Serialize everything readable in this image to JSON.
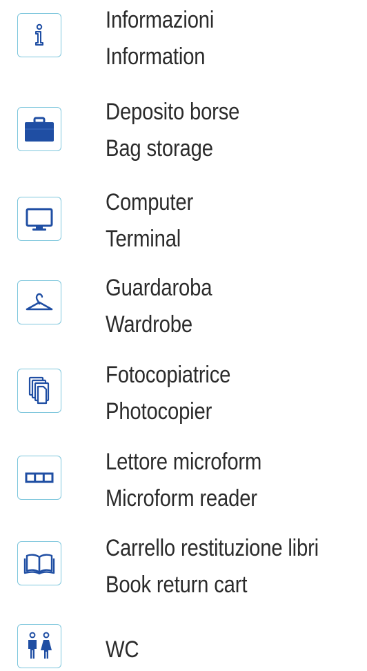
{
  "legend": {
    "items": [
      {
        "icon": "info-icon",
        "label_it": "Informazioni",
        "label_en": "Information"
      },
      {
        "icon": "briefcase-icon",
        "label_it": "Deposito borse",
        "label_en": "Bag storage"
      },
      {
        "icon": "monitor-icon",
        "label_it": "Computer",
        "label_en": "Terminal"
      },
      {
        "icon": "hanger-icon",
        "label_it": "Guardaroba",
        "label_en": "Wardrobe"
      },
      {
        "icon": "copies-icon",
        "label_it": "Fotocopiatrice",
        "label_en": "Photocopier"
      },
      {
        "icon": "microfilm-icon",
        "label_it": "Lettore microform",
        "label_en": "Microform reader"
      },
      {
        "icon": "open-book-icon",
        "label_it": "Carrello restituzione libri",
        "label_en": "Book return cart"
      },
      {
        "icon": "restroom-icon",
        "label_it": "WC"
      }
    ]
  },
  "colors": {
    "icon_blue": "#1f4ea3",
    "box_border": "#7dc6dc",
    "text": "#2b2b2b"
  }
}
